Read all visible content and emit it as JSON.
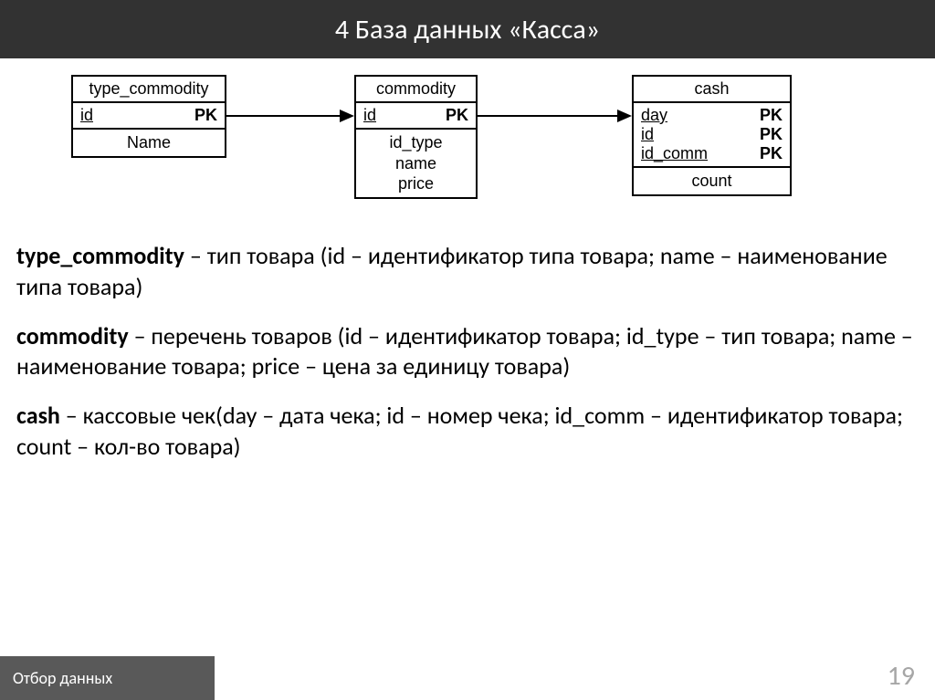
{
  "header": {
    "title": "4  База данных «Касса»"
  },
  "entities": {
    "type_commodity": {
      "title": "type_commodity",
      "keys": [
        {
          "name": "id",
          "tag": "PK"
        }
      ],
      "attrs": [
        "Name"
      ]
    },
    "commodity": {
      "title": "commodity",
      "keys": [
        {
          "name": "id",
          "tag": "PK"
        }
      ],
      "attrs": [
        "id_type",
        "name",
        "price"
      ]
    },
    "cash": {
      "title": "cash",
      "keys": [
        {
          "name": "day",
          "tag": "PK"
        },
        {
          "name": "id",
          "tag": "PK"
        },
        {
          "name": "id_comm",
          "tag": "PK"
        }
      ],
      "attrs": [
        "count"
      ]
    }
  },
  "descriptions": {
    "tc_term": "type_commodity",
    "tc_rest": " – тип товара (id – идентификатор типа товара; name – наименование типа товара)",
    "co_term": "commodity",
    "co_rest": " – перечень товаров (id – идентификатор товара; id_type – тип товара; name – наименование товара; price – цена за единицу товара)",
    "ca_term": "cash",
    "ca_rest": " – кассовые чек(day – дата чека; id – номер чека; id_comm – идентификатор товара; count – кол-во товара)"
  },
  "footer": {
    "left": "Отбор данных",
    "page": "19"
  }
}
